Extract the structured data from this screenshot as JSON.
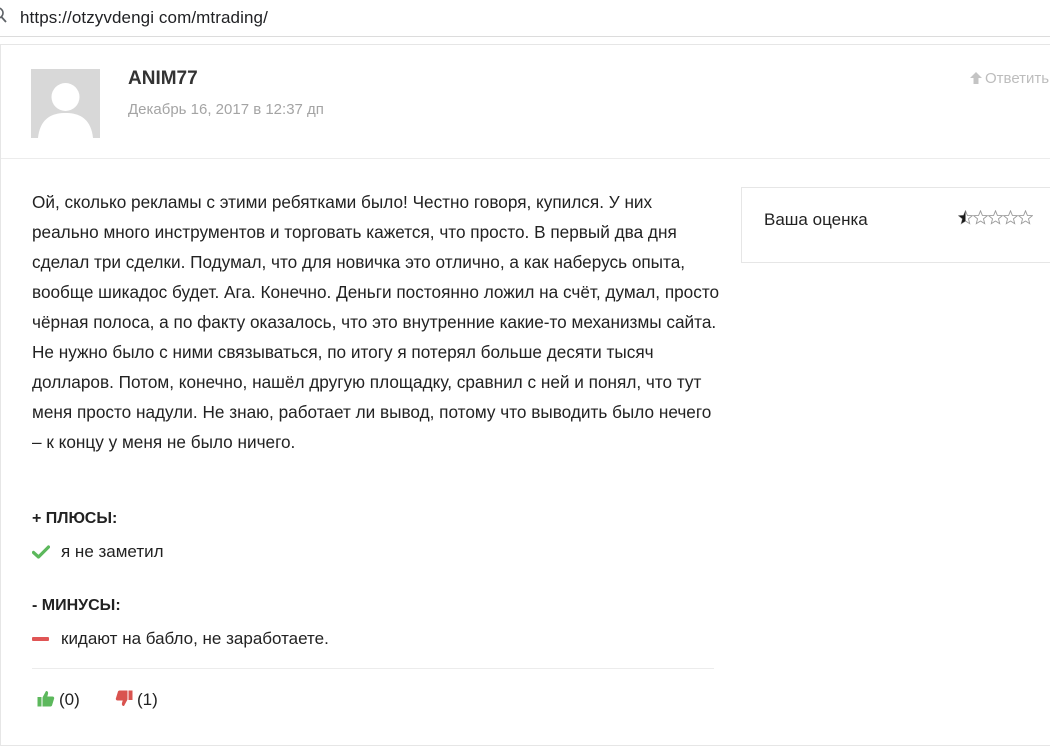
{
  "browser": {
    "url": "https://otzyvdengi com/mtrading/"
  },
  "comment": {
    "author": "ANIM77",
    "date": "Декабрь 16, 2017 в 12:37 дп",
    "reply_label": "Ответить",
    "body": "Ой, сколько рекламы с этими ребятками было! Честно говоря, купился. У них реально много инструментов и торговать кажется, что просто. В первый два дня сделал три сделки. Подумал, что для новичка это отлично, а как наберусь опыта, вообще шикадос будет. Ага. Конечно. Деньги постоянно ложил на счёт, думал, просто чёрная полоса, а по факту оказалось, что это внутренние какие-то механизмы сайта. Не нужно было с ними связываться, по итогу я потерял больше десяти тысяч долларов. Потом, конечно, нашёл другую площадку, сравнил с ней и понял, что тут меня просто надули. Не знаю, работает ли вывод, потому что выводить было нечего – к концу у меня не было ничего.",
    "rating": {
      "label": "Ваша оценка",
      "value": 0.5,
      "max": 5
    },
    "pros": {
      "title": "+ ПЛЮСЫ:",
      "items": [
        "я не заметил"
      ]
    },
    "cons": {
      "title": "- МИНУСЫ:",
      "items": [
        "кидают на бабло, не заработаете."
      ]
    },
    "votes": {
      "up": "(0)",
      "down": "(1)"
    }
  },
  "colors": {
    "check": "#5cb85c",
    "minus": "#e05555",
    "thumb_up": "#5cb85c",
    "thumb_down": "#d9534f",
    "star": "#1b1b1b"
  }
}
